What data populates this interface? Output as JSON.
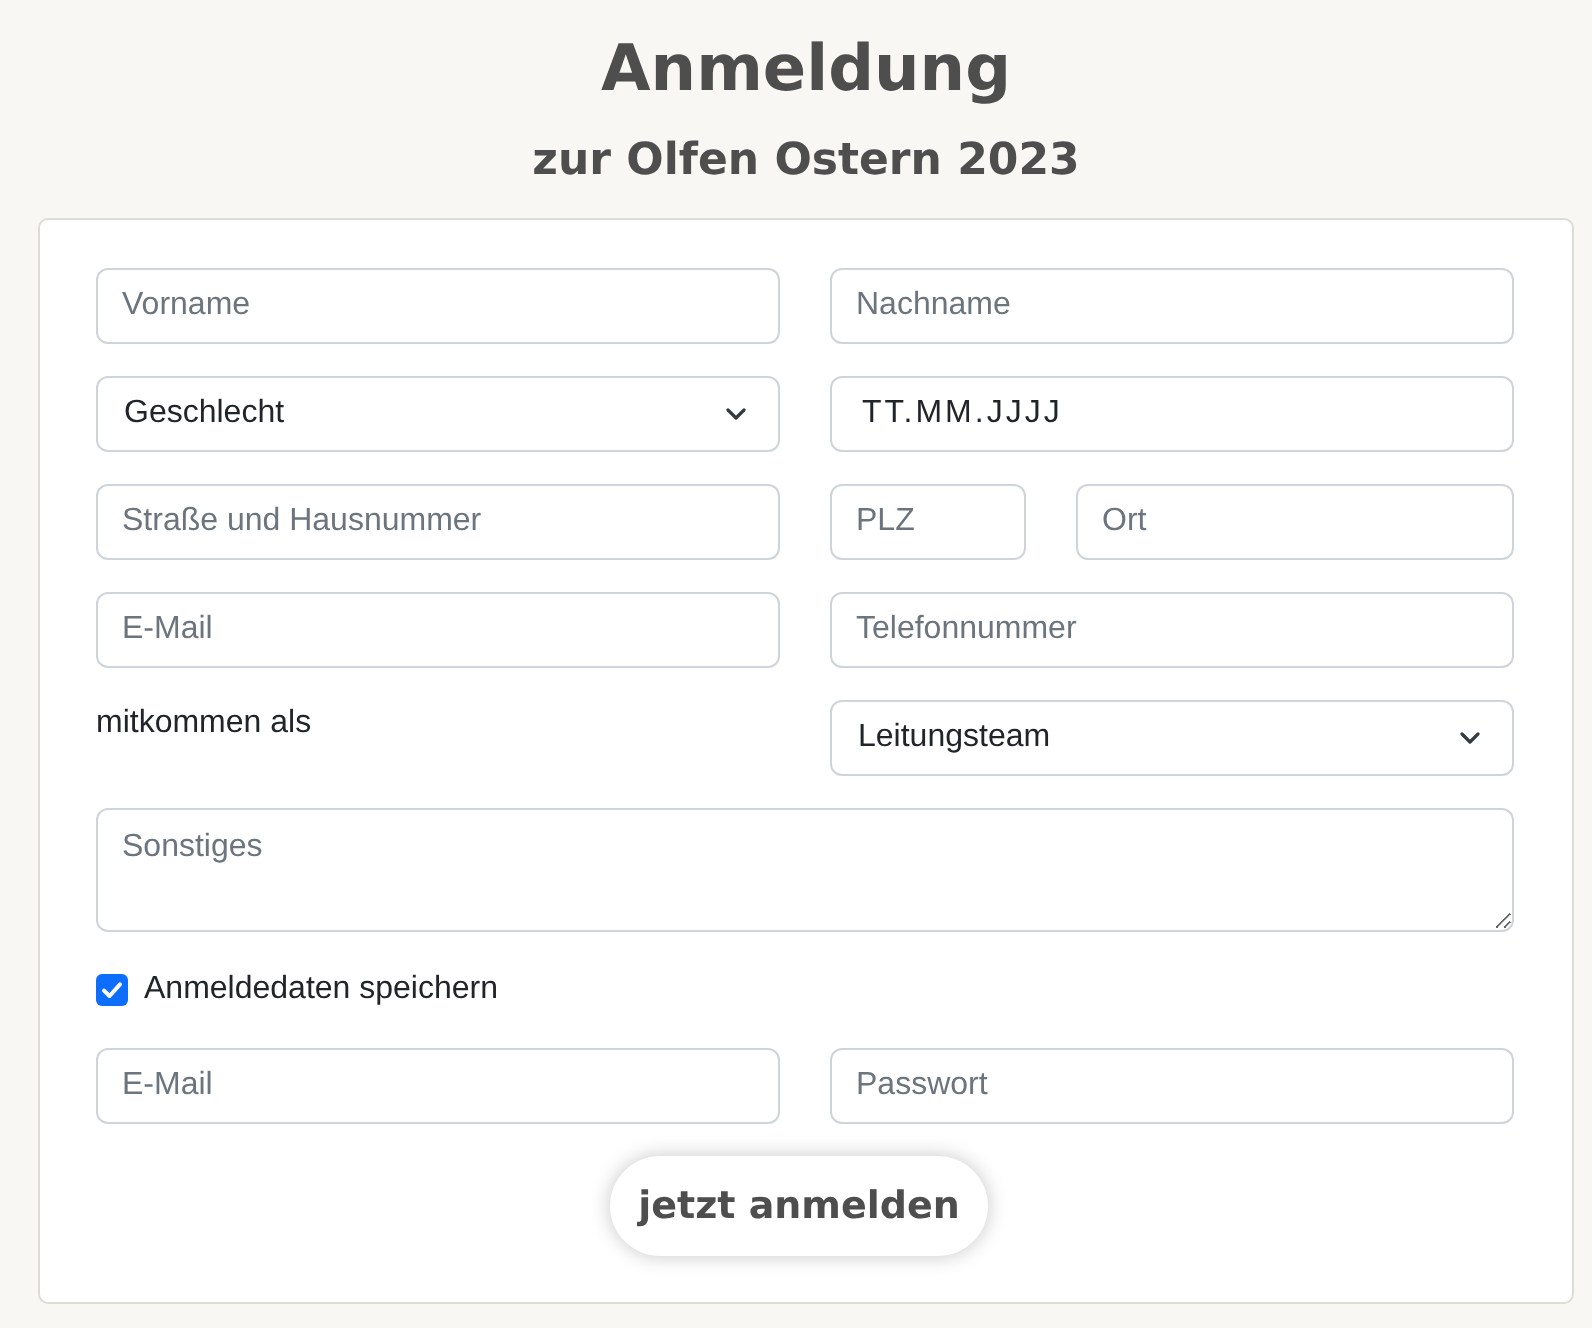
{
  "header": {
    "title": "Anmeldung",
    "subtitle": "zur Olfen Ostern 2023"
  },
  "form": {
    "rows": [
      {
        "cells": [
          {
            "kind": "input",
            "placeholder": "Vorname"
          },
          {
            "kind": "input",
            "placeholder": "Nachname"
          }
        ]
      },
      {
        "cells": [
          {
            "kind": "select",
            "value": "Geschlecht"
          },
          {
            "kind": "date",
            "value": "TT.MM.JJJJ"
          }
        ]
      },
      {
        "cells": [
          {
            "kind": "input",
            "placeholder": "Straße und Hausnummer"
          },
          {
            "kind": "group",
            "fields": [
              {
                "kind": "input",
                "placeholder": "PLZ"
              },
              {
                "kind": "input",
                "placeholder": "Ort"
              }
            ]
          }
        ]
      },
      {
        "cells": [
          {
            "kind": "input",
            "placeholder": "E-Mail"
          },
          {
            "kind": "input",
            "placeholder": "Telefonnummer"
          }
        ]
      },
      {
        "cells": [
          {
            "kind": "label",
            "text": "mitkommen als"
          },
          {
            "kind": "select",
            "value": "Leitungsteam"
          }
        ]
      },
      {
        "cells": [
          {
            "kind": "textarea",
            "placeholder": "Sonstiges"
          }
        ]
      },
      {
        "cells": [
          {
            "kind": "checkbox",
            "label": "Anmeldedaten speichern",
            "checked": true
          }
        ]
      },
      {
        "cells": [
          {
            "kind": "input",
            "placeholder": "E-Mail"
          },
          {
            "kind": "input",
            "placeholder": "Passwort"
          }
        ]
      }
    ],
    "submit": "jetzt anmelden"
  }
}
